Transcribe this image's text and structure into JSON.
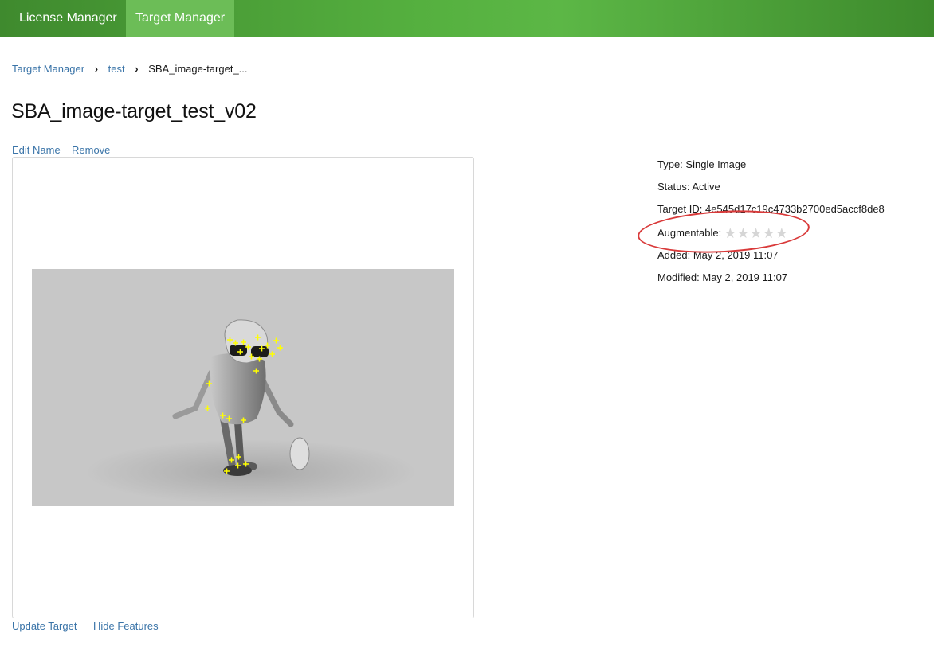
{
  "nav": {
    "tabs": [
      {
        "label": "License Manager",
        "active": false
      },
      {
        "label": "Target Manager",
        "active": true
      }
    ]
  },
  "breadcrumb": {
    "items": [
      "Target Manager",
      "test",
      "SBA_image-target_..."
    ]
  },
  "target": {
    "name": "SBA_image-target_test_v02",
    "edit_name_label": "Edit Name",
    "remove_label": "Remove",
    "update_label": "Update Target",
    "hide_features_label": "Hide Features"
  },
  "details": {
    "type": "Type: Single Image",
    "status": "Status: Active",
    "target_id": "Target ID: 4e545d17c19c4733b2700ed5accf8de8",
    "augmentable_label": "Augmentable:",
    "augmentable_rating": 0,
    "augmentable_max": 5,
    "added": "Added: May 2, 2019 11:07",
    "modified": "Modified: May 2, 2019 11:07"
  },
  "colors": {
    "header_green": "#55b03f",
    "link_blue": "#3a74a8",
    "highlight_red": "#d93a3a",
    "feature_yellow": "#ffff00"
  },
  "icons": {
    "breadcrumb_separator": "chevron-right-icon",
    "rating": "star-icon"
  }
}
